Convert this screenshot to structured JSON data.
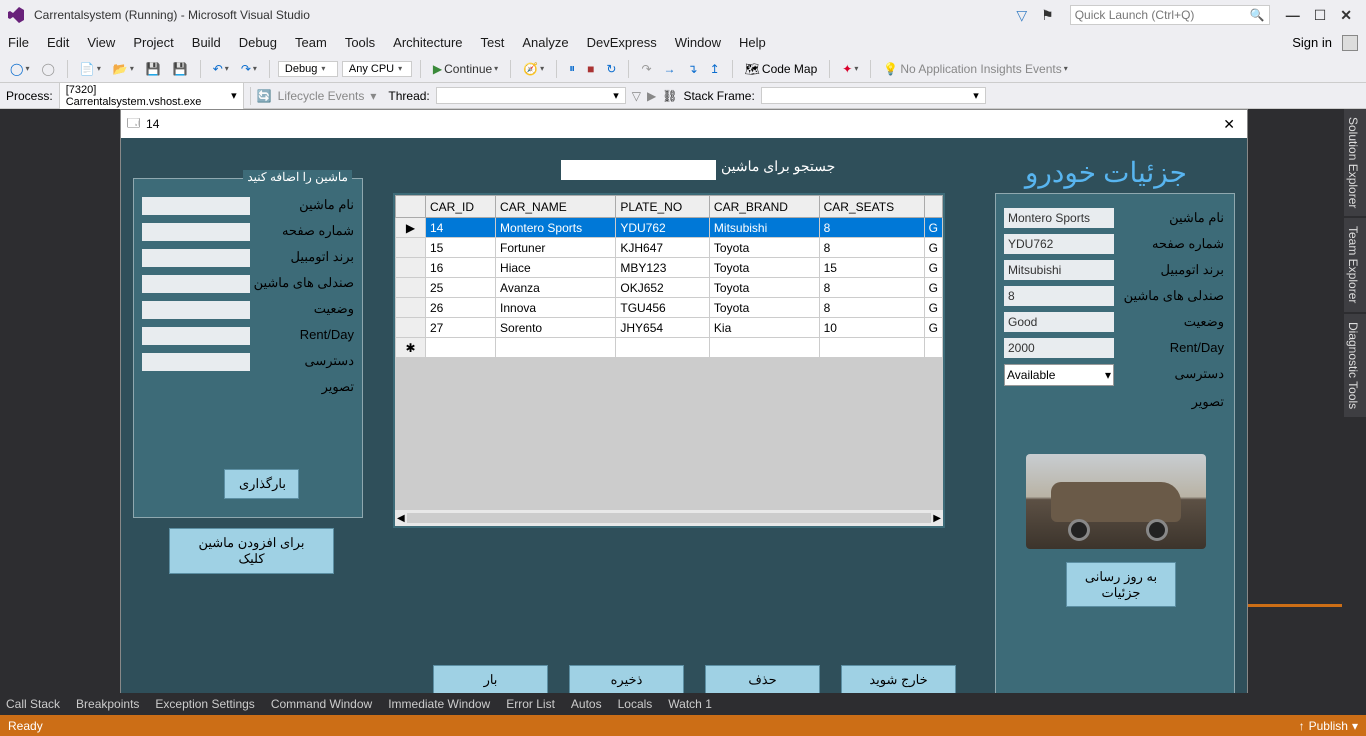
{
  "title": "Carrentalsystem (Running) - Microsoft Visual Studio",
  "quick_launch": "Quick Launch (Ctrl+Q)",
  "menu": [
    "File",
    "Edit",
    "View",
    "Project",
    "Build",
    "Debug",
    "Team",
    "Tools",
    "Architecture",
    "Test",
    "Analyze",
    "DevExpress",
    "Window",
    "Help"
  ],
  "sign_in": "Sign in",
  "toolbar": {
    "debug": "Debug",
    "cpu": "Any CPU",
    "continue": "Continue",
    "codemap": "Code Map",
    "insights": "No Application Insights Events"
  },
  "debugrow": {
    "process_lbl": "Process:",
    "process": "[7320] Carrentalsystem.vshost.exe",
    "lifecycle": "Lifecycle Events",
    "thread": "Thread:",
    "stack": "Stack Frame:"
  },
  "side_tabs": [
    "Solution Explorer",
    "Team Explorer",
    "Diagnostic Tools"
  ],
  "form": {
    "title": "14",
    "add_group_title": "ماشین را اضافه کنید",
    "labels": {
      "name": "نام ماشین",
      "plate": "شماره صفحه",
      "brand": "برند اتومبیل",
      "seats": "صندلی های ماشین",
      "status": "وضعیت",
      "rent": "Rent/Day",
      "access": "دسترسی",
      "image": "تصویر"
    },
    "upload_btn": "بارگذاری",
    "add_click": "برای افزودن ماشین کلیک",
    "search_lbl": "جستجو برای ماشین",
    "details_title": "جزئيات خودرو",
    "details": {
      "name": "Montero Sports",
      "plate": "YDU762",
      "brand": "Mitsubishi",
      "seats": "8",
      "status": "Good",
      "rent": "2000",
      "access": "Available"
    },
    "update_btn": "به روز رسانی جزئيات",
    "bottom": {
      "load": "بار",
      "save": "ذخیره",
      "delete": "حذف",
      "exit": "خارج شوید"
    },
    "grid": {
      "headers": [
        "CAR_ID",
        "CAR_NAME",
        "PLATE_NO",
        "CAR_BRAND",
        "CAR_SEATS",
        ""
      ],
      "rows": [
        [
          "14",
          "Montero Sports",
          "YDU762",
          "Mitsubishi",
          "8",
          "G"
        ],
        [
          "15",
          "Fortuner",
          "KJH647",
          "Toyota",
          "8",
          "G"
        ],
        [
          "16",
          "Hiace",
          "MBY123",
          "Toyota",
          "15",
          "G"
        ],
        [
          "25",
          "Avanza",
          "OKJ652",
          "Toyota",
          "8",
          "G"
        ],
        [
          "26",
          "Innova",
          "TGU456",
          "Toyota",
          "8",
          "G"
        ],
        [
          "27",
          "Sorento",
          "JHY654",
          "Kia",
          "10",
          "G"
        ]
      ]
    }
  },
  "bottom_tabs": [
    "Call Stack",
    "Breakpoints",
    "Exception Settings",
    "Command Window",
    "Immediate Window",
    "Error List",
    "Autos",
    "Locals",
    "Watch 1"
  ],
  "status": {
    "ready": "Ready",
    "publish": "Publish"
  }
}
